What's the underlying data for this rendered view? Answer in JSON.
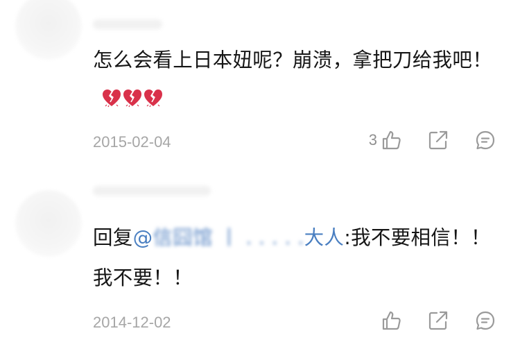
{
  "comments": [
    {
      "text": "怎么会看上日本妞呢？崩溃，拿把刀给我吧！",
      "emoji": "broken-heart x3",
      "date": "2015-02-04",
      "likes": "3"
    },
    {
      "reply_prefix": "回复",
      "mention": "@",
      "mention_tail": "大人",
      "text": ":我不要相信！！我不要！！",
      "date": "2014-12-02",
      "likes": ""
    }
  ],
  "icons": {
    "like": "thumbs-up-icon",
    "share": "share-icon",
    "comment": "comment-icon",
    "heart": "broken-heart-icon"
  },
  "colors": {
    "text": "#161616",
    "date": "#a6a6a6",
    "icon": "#9a9a9a",
    "mention": "#4a7fc1",
    "heart": "#d9314a"
  }
}
